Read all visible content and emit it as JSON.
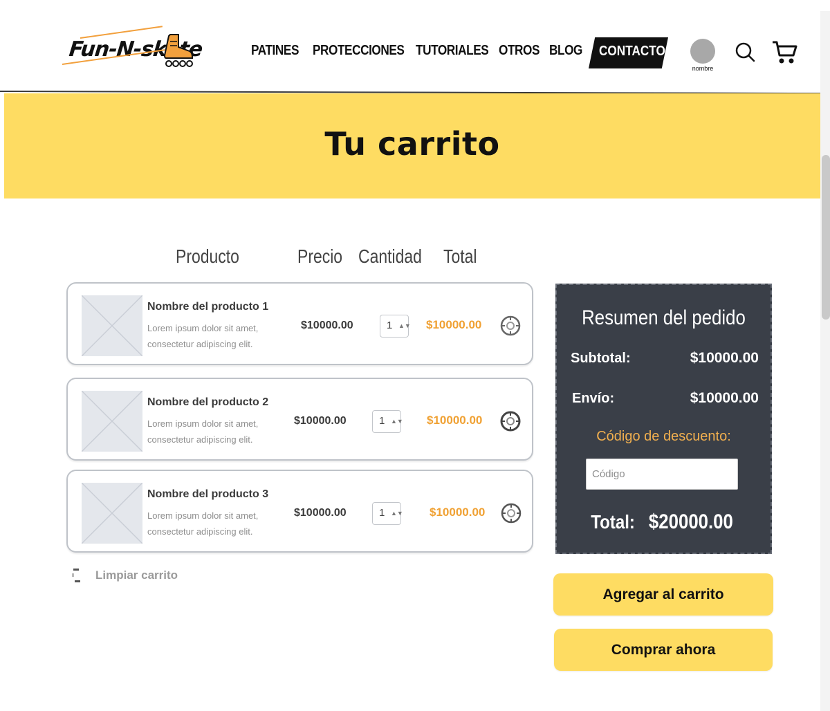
{
  "header": {
    "logo": "Fun-N-skate",
    "nav": [
      "PATINES",
      "PROTECCIONES",
      "TUTORIALES",
      "OTROS",
      "BLOG"
    ],
    "contact_label": "CONTACTO",
    "user_label": "nombre",
    "icons": {
      "search": "search-icon",
      "cart": "cart-icon",
      "user": "avatar-icon"
    }
  },
  "banner": {
    "title": "Tu carrito",
    "color": "#fedc62"
  },
  "table": {
    "headers": [
      "Producto",
      "Precio",
      "Cantidad",
      "Total"
    ]
  },
  "items": [
    {
      "name": "Nombre del producto 1",
      "desc": "Lorem ipsum dolor sit amet, consectetur adipiscing elit.",
      "price": "$10000.00",
      "qty": "1",
      "total": "$10000.00"
    },
    {
      "name": "Nombre del producto 2",
      "desc": "Lorem ipsum dolor sit amet, consectetur adipiscing elit.",
      "price": "$10000.00",
      "qty": "1",
      "total": "$10000.00"
    },
    {
      "name": "Nombre del producto 3",
      "desc": "Lorem ipsum dolor sit amet, consectetur adipiscing elit.",
      "price": "$10000.00",
      "qty": "1",
      "total": "$10000.00"
    }
  ],
  "clear_cart": "Limpiar carrito",
  "summary": {
    "title": "Resumen del pedido",
    "subtotal_label": "Subtotal:",
    "subtotal_value": "$10000.00",
    "shipping_label": "Envío:",
    "shipping_value": "$10000.00",
    "discount_label": "Código de descuento:",
    "discount_placeholder": "Código",
    "total_label": "Total:",
    "total_value": "$20000.00"
  },
  "buttons": {
    "add_to_cart": "Agregar al carrito",
    "buy_now": "Comprar ahora"
  },
  "colors": {
    "accent": "#fedc62",
    "summary_bg": "#3a3f48",
    "price_orange": "#f0a133",
    "discount_label": "#f2b04f"
  }
}
